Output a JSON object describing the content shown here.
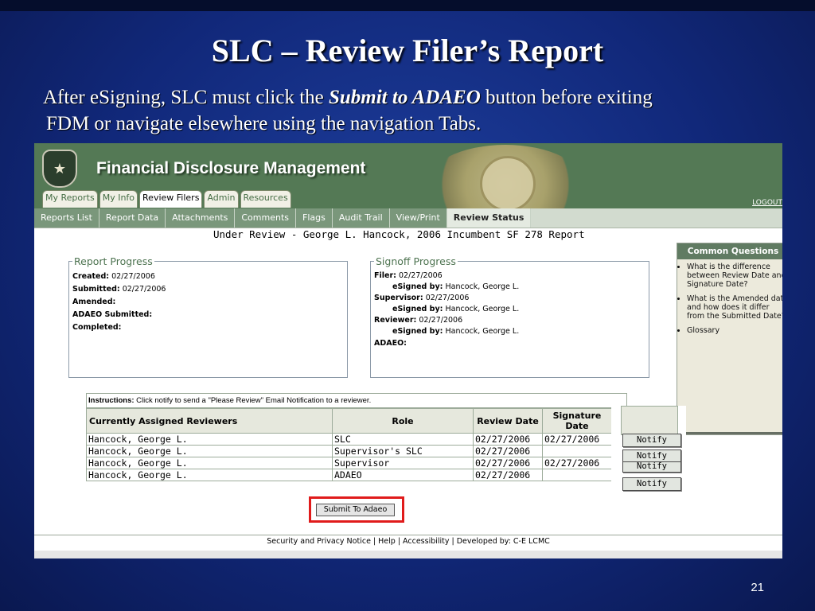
{
  "slide": {
    "title": "SLC – Review Filer’s Report",
    "subtitle_pre": "After eSigning, SLC must click the ",
    "subtitle_em": "Submit to ADAEO",
    "subtitle_post": " button before exiting",
    "subtitle_line2": "FDM or navigate elsewhere using the navigation Tabs.",
    "page_number": "21"
  },
  "app": {
    "title": "Financial Disclosure Management",
    "logout": "LOGOUT",
    "main_tabs": [
      {
        "label": "My Reports",
        "active": false
      },
      {
        "label": "My Info",
        "active": false
      },
      {
        "label": "Review Filers",
        "active": true
      },
      {
        "label": "Admin",
        "active": false
      },
      {
        "label": "Resources",
        "active": false
      }
    ],
    "sub_tabs": [
      {
        "label": "Reports List",
        "active": false
      },
      {
        "label": "Report Data",
        "active": false
      },
      {
        "label": "Attachments",
        "active": false
      },
      {
        "label": "Comments",
        "active": false
      },
      {
        "label": "Flags",
        "active": false
      },
      {
        "label": "Audit Trail",
        "active": false
      },
      {
        "label": "View/Print",
        "active": false
      },
      {
        "label": "Review Status",
        "active": true
      }
    ],
    "report_heading": "Under Review - George L. Hancock, 2006 Incumbent SF 278 Report"
  },
  "report_progress": {
    "legend": "Report Progress",
    "created_label": "Created:",
    "created_value": "02/27/2006",
    "submitted_label": "Submitted:",
    "submitted_value": "02/27/2006",
    "amended_label": "Amended:",
    "adaeo_submitted_label": "ADAEO Submitted:",
    "completed_label": "Completed:"
  },
  "signoff_progress": {
    "legend": "Signoff Progress",
    "esigned_label": "eSigned by:",
    "filer_label": "Filer:",
    "filer_date": "02/27/2006",
    "filer_signer": "Hancock, George L.",
    "supervisor_label": "Supervisor:",
    "supervisor_date": "02/27/2006",
    "supervisor_signer": "Hancock, George L.",
    "reviewer_label": "Reviewer:",
    "reviewer_date": "02/27/2006",
    "reviewer_signer": "Hancock, George L.",
    "adaeo_label": "ADAEO:"
  },
  "common_questions": {
    "title": "Common Questions",
    "items": [
      "What is the difference between Review Date and Signature Date?",
      "What is the Amended date and how does it differ from the Submitted Date?",
      "Glossary"
    ]
  },
  "instructions": {
    "label": "Instructions:",
    "text": " Click notify to send a \"Please Review\" Email Notification to a reviewer."
  },
  "reviewers_table": {
    "headers": [
      "Currently Assigned Reviewers",
      "Role",
      "Review Date",
      "Signature Date"
    ],
    "rows": [
      {
        "name": "Hancock, George L.",
        "role": "SLC",
        "review_date": "02/27/2006",
        "signature_date": "02/27/2006"
      },
      {
        "name": "Hancock, George L.",
        "role": "Supervisor's SLC",
        "review_date": "02/27/2006",
        "signature_date": ""
      },
      {
        "name": "Hancock, George L.",
        "role": "Supervisor",
        "review_date": "02/27/2006",
        "signature_date": "02/27/2006"
      },
      {
        "name": "Hancock, George L.",
        "role": "ADAEO",
        "review_date": "02/27/2006",
        "signature_date": ""
      }
    ],
    "notify_label": "Notify"
  },
  "submit_button": "Submit To Adaeo",
  "footer": "Security and Privacy Notice | Help | Accessibility | Developed by: C-E LCMC"
}
